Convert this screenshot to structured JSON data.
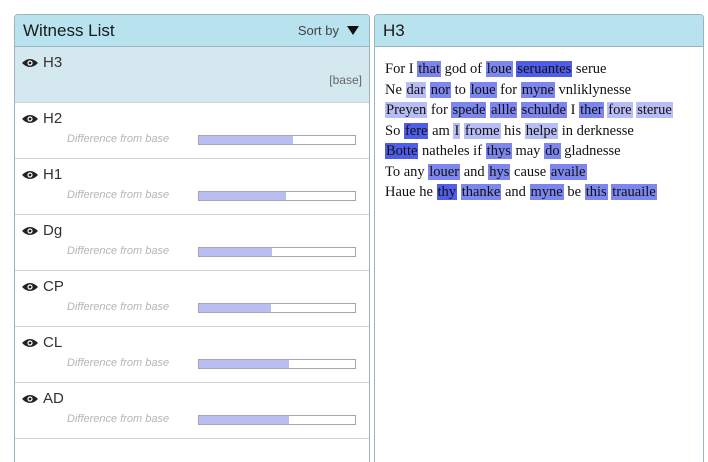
{
  "witness_panel": {
    "title": "Witness List",
    "sort_label": "Sort by",
    "diff_label": "Difference from base",
    "base_tag": "[base]",
    "witnesses": [
      {
        "name": "H3",
        "selected": true,
        "is_base": true
      },
      {
        "name": "H2",
        "difference": 0.6
      },
      {
        "name": "H1",
        "difference": 0.56
      },
      {
        "name": "Dg",
        "difference": 0.47
      },
      {
        "name": "CP",
        "difference": 0.46
      },
      {
        "name": "CL",
        "difference": 0.58
      },
      {
        "name": "AD",
        "difference": 0.58
      }
    ]
  },
  "text_panel": {
    "title": "H3",
    "lines": [
      [
        [
          "For I ",
          0
        ],
        [
          "that",
          2
        ],
        [
          " god of ",
          0
        ],
        [
          "loue",
          2
        ],
        [
          " ",
          0
        ],
        [
          "seruantes",
          1
        ],
        [
          " serue",
          0
        ]
      ],
      [
        [
          "Ne ",
          0
        ],
        [
          "dar",
          3
        ],
        [
          " ",
          0
        ],
        [
          "nor",
          2
        ],
        [
          " to ",
          0
        ],
        [
          "loue",
          2
        ],
        [
          " for ",
          0
        ],
        [
          "myne",
          2
        ],
        [
          " vnliklynesse",
          0
        ]
      ],
      [
        [
          "Preyen",
          3
        ],
        [
          " for ",
          0
        ],
        [
          "spede",
          2
        ],
        [
          " ",
          0
        ],
        [
          "allle",
          2
        ],
        [
          " ",
          0
        ],
        [
          "schulde",
          2
        ],
        [
          " I ",
          0
        ],
        [
          "ther",
          2
        ],
        [
          " ",
          0
        ],
        [
          "fore",
          3
        ],
        [
          " ",
          0
        ],
        [
          "sterue",
          3
        ]
      ],
      [
        [
          "So ",
          0
        ],
        [
          "fere",
          1
        ],
        [
          " am ",
          0
        ],
        [
          "I",
          3
        ],
        [
          " ",
          0
        ],
        [
          "frome",
          3
        ],
        [
          " his ",
          0
        ],
        [
          "helpe",
          3
        ],
        [
          " in derknesse",
          0
        ]
      ],
      [
        [
          "Botte",
          1
        ],
        [
          " natheles if ",
          0
        ],
        [
          "thys",
          2
        ],
        [
          " may ",
          0
        ],
        [
          "do",
          2
        ],
        [
          " gladnesse",
          0
        ]
      ],
      [
        [
          "To any ",
          0
        ],
        [
          "louer",
          2
        ],
        [
          " and ",
          0
        ],
        [
          "hys",
          2
        ],
        [
          " cause ",
          0
        ],
        [
          "availe",
          2
        ]
      ],
      [
        [
          "Haue he ",
          0
        ],
        [
          "thy",
          1
        ],
        [
          " ",
          0
        ],
        [
          "thanke",
          2
        ],
        [
          " and ",
          0
        ],
        [
          "myne",
          2
        ],
        [
          " be ",
          0
        ],
        [
          "this",
          2
        ],
        [
          " ",
          0
        ],
        [
          "trauaile",
          2
        ]
      ]
    ]
  },
  "colors": {
    "header_bg": "#b8e2ee",
    "selected_row_bg": "#d3e8ef",
    "highlight_strong": "#4f5de8",
    "highlight_medium": "#7d86ef",
    "highlight_light": "#b8bdf5",
    "bar_fill": "#b9bdf2"
  },
  "icons": {
    "visibility": "eye-icon",
    "sort": "triangle-down-icon"
  }
}
